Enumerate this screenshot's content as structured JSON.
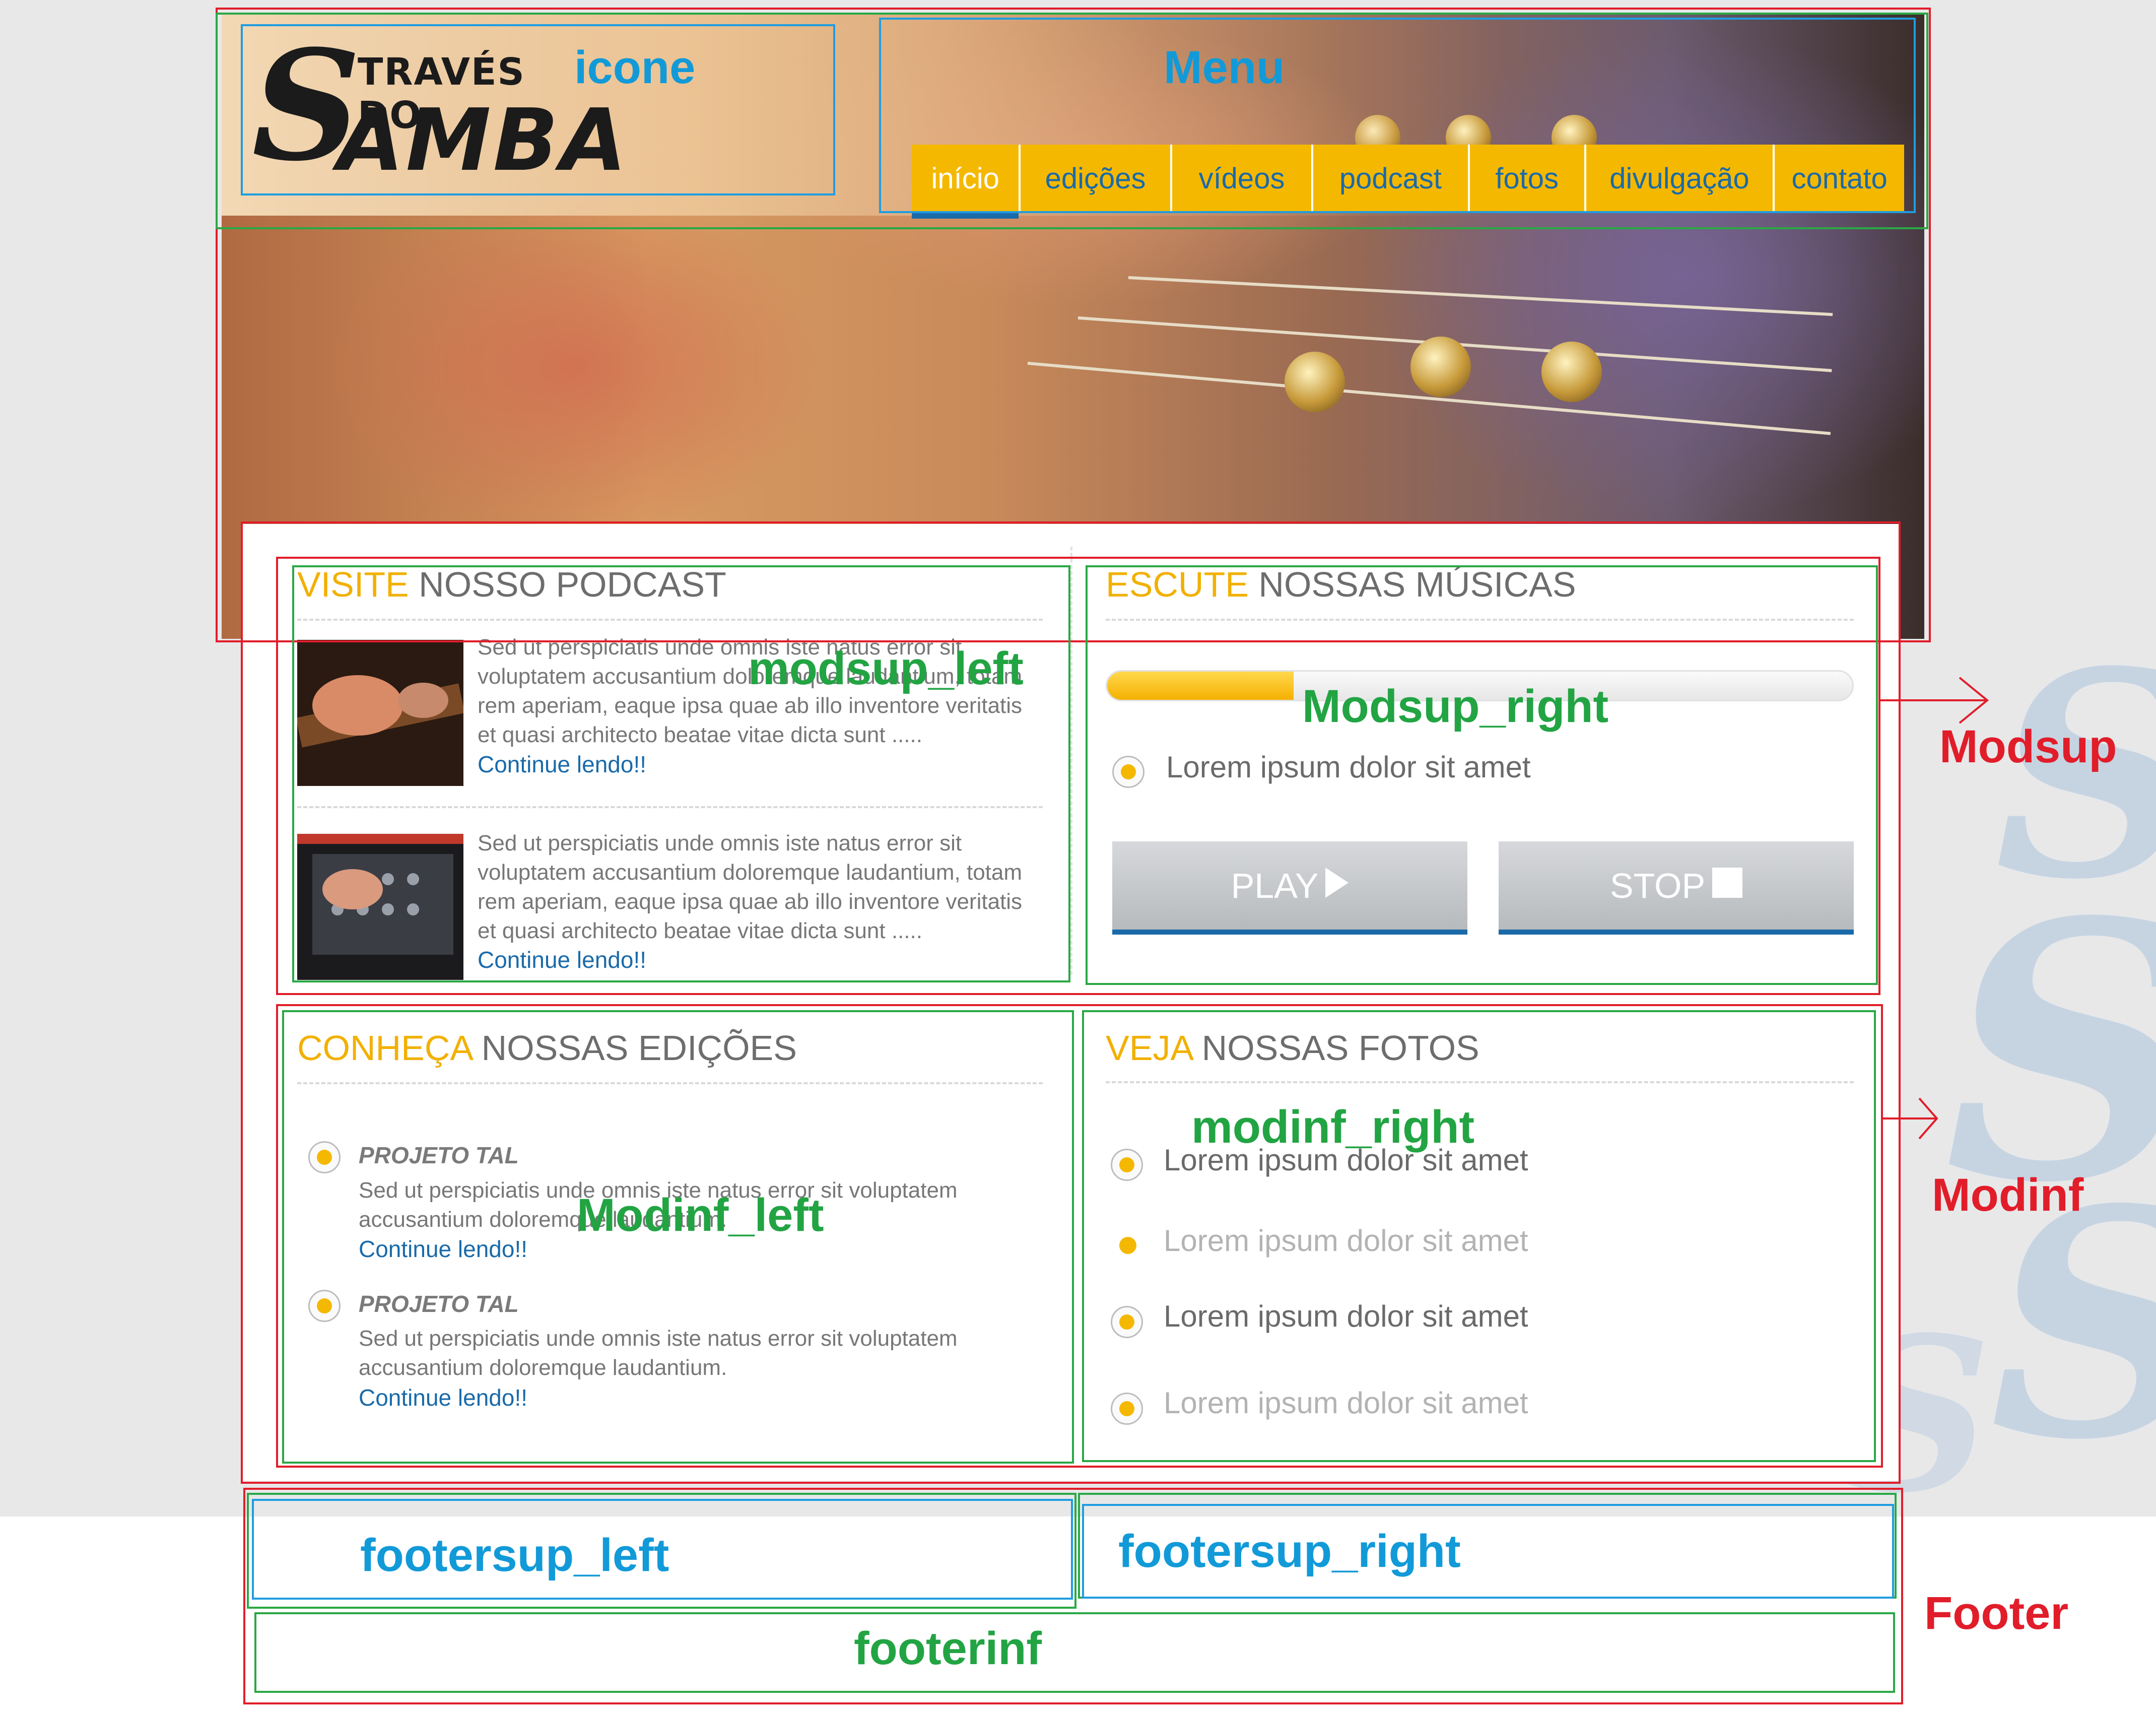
{
  "brand": {
    "logo_initial": "S",
    "logo_line1": "TRAVÉS DO",
    "logo_line2": "AMBA"
  },
  "menu": {
    "items": [
      "início",
      "edições",
      "vídeos",
      "podcast",
      "fotos",
      "divulgação",
      "contato"
    ],
    "active_index": 0
  },
  "modsup_left": {
    "heading_accent": "VISITE",
    "heading_rest": " NOSSO PODCAST",
    "posts": [
      {
        "text": "Sed ut perspiciatis unde omnis iste natus error sit voluptatem accusantium doloremque laudantium, totam rem aperiam, eaque ipsa quae ab illo inventore veritatis et quasi architecto beatae vitae dicta sunt .....",
        "link": "Continue lendo!!"
      },
      {
        "text": "Sed ut perspiciatis unde omnis iste natus error sit voluptatem accusantium doloremque laudantium, totam rem aperiam, eaque ipsa quae ab illo inventore veritatis et quasi architecto beatae vitae dicta sunt .....",
        "link": "Continue lendo!!"
      }
    ]
  },
  "modsup_right": {
    "heading_accent": "ESCUTE",
    "heading_rest": " NOSSAS MÚSICAS",
    "progress": 0.25,
    "track": "Lorem ipsum dolor sit amet",
    "play_label": "PLAY",
    "stop_label": "STOP"
  },
  "modinf_left": {
    "heading_accent": "CONHEÇA",
    "heading_rest": " NOSSAS EDIÇÕES",
    "items": [
      {
        "title": "PROJETO TAL",
        "text": "Sed ut perspiciatis unde omnis iste natus error sit voluptatem accusantium doloremque laudantium.",
        "link": "Continue lendo!!"
      },
      {
        "title": "PROJETO TAL",
        "text": "Sed ut perspiciatis unde omnis iste natus error sit voluptatem accusantium doloremque laudantium.",
        "link": "Continue lendo!!"
      }
    ]
  },
  "modinf_right": {
    "heading_accent": "VEJA",
    "heading_rest": " NOSSAS FOTOS",
    "options": [
      "Lorem ipsum dolor sit amet",
      "Lorem ipsum dolor sit amet",
      "Lorem ipsum dolor sit amet",
      "Lorem ipsum dolor sit amet"
    ]
  },
  "annotations": {
    "icone": "icone",
    "menu": "Menu",
    "modsup_left": "modsup_left",
    "modsup_right": "Modsup_right",
    "modsup": "Modsup",
    "modinf_left": "Modinf_left",
    "modinf_right": "modinf_right",
    "modinf": "Modinf",
    "footersup_left": "footersup_left",
    "footersup_right": "footersup_right",
    "footerinf": "footerinf",
    "footer": "Footer"
  },
  "colors": {
    "accent": "#f5b800",
    "link": "#1a6aa9",
    "annotation_red": "#e11d2a",
    "annotation_green": "#2aa845",
    "annotation_blue": "#1f9de0"
  }
}
